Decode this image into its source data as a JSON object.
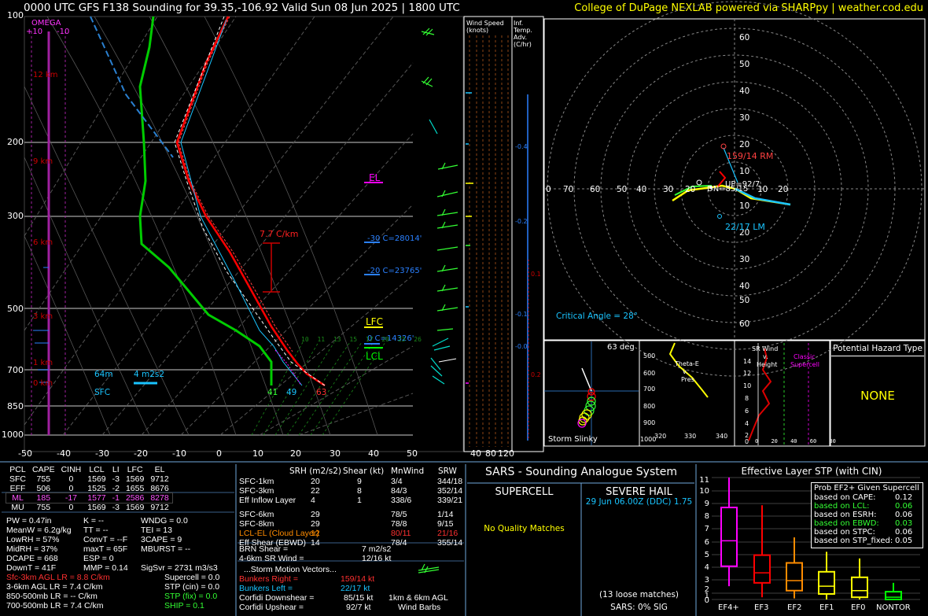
{
  "header": {
    "title": "0000 UTC GFS F138 Sounding for 39.35,-106.92 Valid  Sun 08 Jun 2025 | 1800 UTC",
    "credit": "College of DuPage NEXLAB powered via SHARPpy | weather.cod.edu"
  },
  "skewt": {
    "pressure_ticks": [
      "100",
      "200",
      "300",
      "400",
      "500",
      "600",
      "700",
      "850",
      "1000"
    ],
    "temp_ticks": [
      "-50",
      "-40",
      "-30",
      "-20",
      "-10",
      "0",
      "10",
      "20",
      "30",
      "40",
      "50"
    ],
    "omega_label": "OMEGA",
    "omega_plus": "+10",
    "omega_minus": "-10",
    "height_labels": [
      "12 km",
      "9 km",
      "6 km",
      "3 km",
      "1 km",
      "0 km"
    ],
    "lapse_rate_label": "7.7 C/km",
    "el_label": "EL",
    "lfc_label": "LFC",
    "lcl_label": "LCL",
    "isotherm_label_30": "-30 C=28014'",
    "isotherm_label_20": "-20 C=23765'",
    "isotherm_label_0": "0 C=14326'",
    "eff_inflow_depth": "64m",
    "eff_inflow_srh": "4 m2s2",
    "sfc_label": "SFC",
    "sfc_td": "41",
    "sfc_tw": "49",
    "sfc_t": "63",
    "mixing_ratios": [
      "10",
      "11",
      "13",
      "15",
      "17",
      "20",
      "23",
      "26"
    ]
  },
  "wind_speed_panel": {
    "title": "Wind Speed (knots)",
    "ticks": [
      "40",
      "80",
      "120"
    ]
  },
  "temp_adv_panel": {
    "title": "Inf. Temp. Adv. (C/hr)",
    "values": [
      "-0.4",
      "-0.2",
      "0.1",
      "-0.1",
      "-0.0",
      "0.2"
    ]
  },
  "hodograph": {
    "rings_top": [
      "60",
      "50",
      "40",
      "30",
      "20",
      "10"
    ],
    "rings_bottom": [
      "10",
      "20",
      "30",
      "40",
      "50",
      "60"
    ],
    "rings_left": [
      "0",
      "70",
      "60",
      "50",
      "40",
      "30",
      "20"
    ],
    "rings_right": [
      "10",
      "20"
    ],
    "rm_label": "159/14 RM",
    "lm_label": "22/17 LM",
    "up_label": "UP=92/7",
    "dn_label": "DN=85/15",
    "critical_angle": "Critical Angle = 28°"
  },
  "storm_slinky": {
    "angle": "63 deg",
    "label": "Storm Slinky"
  },
  "theta_panel": {
    "label1": "Theta-E",
    "label2": "v.",
    "label3": "Pres",
    "pressures": [
      "500",
      "600",
      "700",
      "800",
      "900",
      "1000"
    ],
    "x_ticks": [
      "320",
      "330",
      "340"
    ]
  },
  "srwind_panel": {
    "title1": "SR Wind",
    "title2": "v.",
    "title3": "Height",
    "classic": "Classic",
    "supercell": "Supercell",
    "heights": [
      "14",
      "12",
      "10",
      "8",
      "6",
      "4",
      "2",
      "0"
    ],
    "x_ticks": [
      "0",
      "20",
      "40",
      "60",
      "80"
    ]
  },
  "hazard": {
    "title": "Potential Hazard Type",
    "value": "NONE"
  },
  "parcels": {
    "headers": [
      "PCL",
      "CAPE",
      "CINH",
      "LCL",
      "LI",
      "LFC",
      "EL"
    ],
    "rows": [
      [
        "SFC",
        "755",
        "0",
        "1569",
        "-3",
        "1569",
        "9712"
      ],
      [
        "EFF",
        "506",
        "0",
        "1525",
        "-2",
        "1655",
        "8676"
      ],
      [
        "ML",
        "185",
        "-17",
        "1577",
        "-1",
        "2586",
        "8278"
      ],
      [
        "MU",
        "755",
        "0",
        "1569",
        "-3",
        "1569",
        "9712"
      ]
    ]
  },
  "indices": {
    "pw": "PW = 0.47in",
    "k": "K = --",
    "wndg": "WNDG = 0.0",
    "meanw": "MeanW = 6.2g/kg",
    "tt": "TT = --",
    "tei": "TEI = 13",
    "lowrh": "LowRH = 57%",
    "convt": "ConvT = --F",
    "cape3": "3CAPE = 9",
    "midrh": "MidRH = 37%",
    "maxt": "maxT = 65F",
    "mburst": "MBURST = --",
    "dcape": "DCAPE = 668",
    "esp": "ESP = 0",
    "downt": "DownT = 41F",
    "mmp": "MMP = 0.14",
    "sigsvr": "SigSvr = 2731 m3/s3"
  },
  "lapse_rates": {
    "sfc3": "Sfc-3km AGL LR = 8.8 C/km",
    "km36": "3-6km AGL LR = 7.4 C/km",
    "mb850": "850-500mb LR = -- C/km",
    "mb700": "700-500mb LR = 7.4 C/km"
  },
  "composites": {
    "supercell": "Supercell = 0.0",
    "stp_cin": "STP (cin) = 0.0",
    "stp_fix": "STP (fix) = 0.0",
    "ship": "SHIP = 0.1"
  },
  "kinematics": {
    "headers": [
      "SRH (m2/s2)",
      "Shear (kt)",
      "MnWind",
      "SRW"
    ],
    "rows": [
      [
        "SFC-1km",
        "20",
        "9",
        "3/4",
        "344/18"
      ],
      [
        "SFC-3km",
        "22",
        "8",
        "84/3",
        "352/14"
      ],
      [
        "Eff Inflow Layer",
        "4",
        "1",
        "338/6",
        "339/21"
      ],
      [
        "SFC-6km",
        "29",
        "",
        "78/5",
        "1/14"
      ],
      [
        "SFC-8km",
        "29",
        "",
        "78/8",
        "9/15"
      ],
      [
        "LCL-EL (Cloud Layer)",
        "12",
        "",
        "80/11",
        "21/16"
      ],
      [
        "Eff Shear (EBWD)",
        "14",
        "",
        "78/4",
        "355/14"
      ]
    ],
    "brn": "BRN Shear =",
    "brn_val": "7 m2/s2",
    "sr46": "4-6km SR Wind =",
    "sr46_val": "12/16 kt",
    "vectors_title": "...Storm Motion Vectors...",
    "bunkers_right": "Bunkers Right =",
    "bunkers_right_val": "159/14 kt",
    "bunkers_left": "Bunkers Left =",
    "bunkers_left_val": "22/17 kt",
    "corfidi_down": "Corfidi Downshear =",
    "corfidi_down_val": "85/15 kt",
    "corfidi_up": "Corfidi Upshear =",
    "corfidi_up_val": "92/7 kt",
    "barbs_label1": "1km & 6km AGL",
    "barbs_label2": "Wind Barbs"
  },
  "sars": {
    "title": "SARS - Sounding Analogue System",
    "supercell": "SUPERCELL",
    "hail": "SEVERE HAIL",
    "supercell_text": "No Quality Matches",
    "hail_match": "29 Jun 06.00Z (DDC)  1.75",
    "loose": "(13 loose matches)",
    "sig": "SARS: 0% SIG"
  },
  "stp": {
    "title": "Effective Layer STP (with CIN)",
    "y_ticks": [
      "11",
      "10",
      "9",
      "8",
      "7",
      "6",
      "5",
      "4",
      "3",
      "2",
      "1",
      "0"
    ],
    "categories": [
      "EF4+",
      "EF3",
      "EF2",
      "EF1",
      "EF0",
      "NONTOR"
    ],
    "colors": [
      "#ff00ff",
      "#ff0000",
      "#ff8c00",
      "#ffff00",
      "#ffff00",
      "#00ff00"
    ],
    "prob_title": "Prob EF2+ Given Supercell",
    "prob_rows": [
      [
        "based on CAPE:",
        "0.12"
      ],
      [
        "based on LCL:",
        "0.06"
      ],
      [
        "based on ESRH:",
        "0.06"
      ],
      [
        "based on EBWD:",
        "0.03"
      ],
      [
        "based on STPC:",
        "0.06"
      ],
      [
        "based on STP_fixed:",
        "0.05"
      ]
    ]
  },
  "chart_data": {
    "type": "box",
    "title": "Effective Layer STP (with CIN)",
    "categories": [
      "EF4+",
      "EF3",
      "EF2",
      "EF1",
      "EF0",
      "NONTOR"
    ],
    "series": [
      {
        "whisker_low": [
          1.2,
          0.2,
          0.1,
          0.0,
          0.0,
          0.0
        ],
        "q1": [
          3.0,
          1.5,
          0.8,
          0.5,
          0.2,
          0.0
        ],
        "median": [
          5.3,
          2.4,
          1.7,
          1.2,
          0.8,
          0.2
        ],
        "q3": [
          8.3,
          4.0,
          3.3,
          2.5,
          2.0,
          0.7
        ],
        "whisker_high": [
          11.0,
          8.5,
          5.6,
          4.3,
          3.7,
          1.5
        ]
      }
    ],
    "ylim": [
      0,
      11
    ]
  }
}
